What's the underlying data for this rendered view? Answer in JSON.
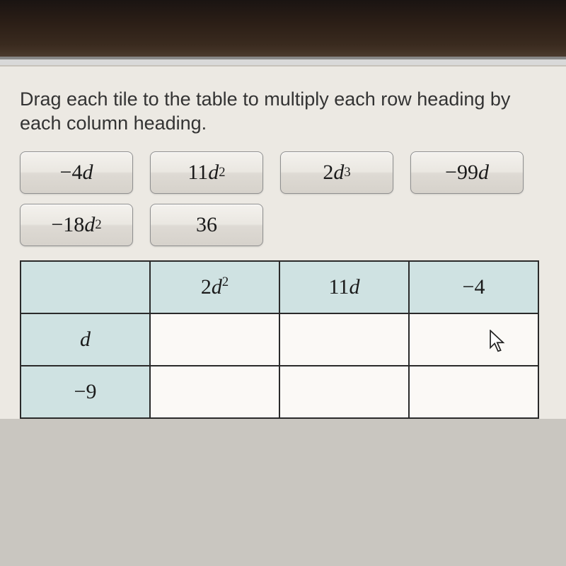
{
  "instruction": "Drag each tile to the table to multiply each row heading by each column heading.",
  "tiles": [
    {
      "base": "−4",
      "var": "d",
      "exp": ""
    },
    {
      "base": "11",
      "var": "d",
      "exp": "2"
    },
    {
      "base": "2",
      "var": "d",
      "exp": "3"
    },
    {
      "base": "−99",
      "var": "d",
      "exp": ""
    },
    {
      "base": "−18",
      "var": "d",
      "exp": "2"
    },
    {
      "base": "36",
      "var": "",
      "exp": ""
    }
  ],
  "columns": [
    {
      "base": "2",
      "var": "d",
      "exp": "2"
    },
    {
      "base": "11",
      "var": "d",
      "exp": ""
    },
    {
      "base": "−4",
      "var": "",
      "exp": ""
    }
  ],
  "rows": [
    {
      "base": "",
      "var": "d",
      "exp": ""
    },
    {
      "base": "−9",
      "var": "",
      "exp": ""
    }
  ]
}
